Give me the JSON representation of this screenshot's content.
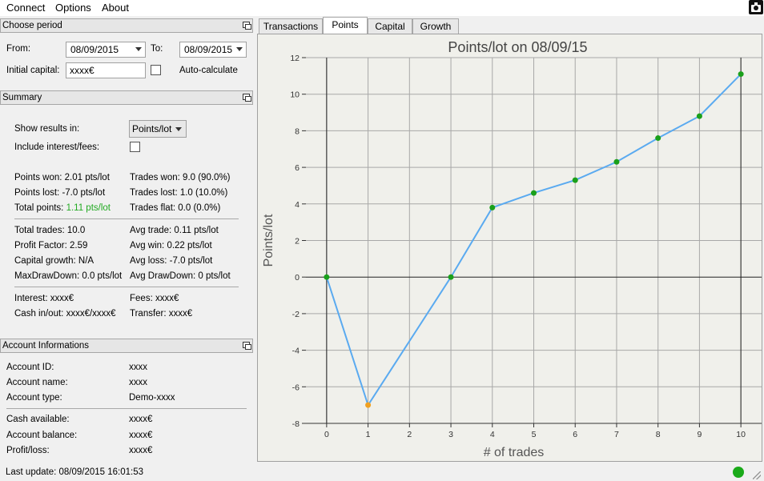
{
  "menu": {
    "connect": "Connect",
    "options": "Options",
    "about": "About"
  },
  "period": {
    "title": "Choose period",
    "from_label": "From:",
    "from_value": "08/09/2015",
    "to_label": "To:",
    "to_value": "08/09/2015",
    "capital_label": "Initial capital:",
    "capital_value": "xxxx€",
    "auto_label": "Auto-calculate"
  },
  "summary": {
    "title": "Summary",
    "show_label": "Show results in:",
    "show_value": "Points/lot",
    "interest_label": "Include interest/fees:",
    "points_won": "Points won: 2.01 pts/lot",
    "points_lost": "Points lost: -7.0 pts/lot",
    "total_points_label": "Total points:",
    "total_points_value": "1.11 pts/lot",
    "trades_won": "Trades won: 9.0 (90.0%)",
    "trades_lost": "Trades lost: 1.0 (10.0%)",
    "trades_flat": "Trades flat: 0.0 (0.0%)",
    "total_trades": "Total trades: 10.0",
    "profit_factor": "Profit Factor: 2.59",
    "capital_growth": "Capital growth: N/A",
    "max_drawdown": "MaxDrawDown: 0.0 pts/lot",
    "avg_trade": "Avg trade: 0.11 pts/lot",
    "avg_win": "Avg win: 0.22 pts/lot",
    "avg_loss": "Avg loss: -7.0 pts/lot",
    "avg_drawdown": "Avg DrawDown: 0 pts/lot",
    "interest": "Interest: xxxx€",
    "fees": "Fees: xxxx€",
    "cash": "Cash in/out: xxxx€/xxxx€",
    "transfer": "Transfer: xxxx€",
    "green": "#22aa22"
  },
  "account": {
    "title": "Account Informations",
    "rows": [
      {
        "label": "Account ID:",
        "value": "xxxx"
      },
      {
        "label": "Account name:",
        "value": "xxxx"
      },
      {
        "label": "Account type:",
        "value": "Demo-xxxx"
      },
      {
        "label": "Cash available:",
        "value": "xxxx€"
      },
      {
        "label": "Account balance:",
        "value": "xxxx€"
      },
      {
        "label": "Profit/loss:",
        "value": "xxxx€"
      }
    ]
  },
  "status": {
    "last_update": "Last update: 08/09/2015 16:01:53"
  },
  "tabs": [
    "Transactions",
    "Points",
    "Capital",
    "Growth"
  ],
  "icons": {
    "camera": "camera-icon",
    "status": "status-dot-icon"
  },
  "chart_data": {
    "type": "line",
    "title": "Points/lot on 08/09/15",
    "xlabel": "# of trades",
    "ylabel": "Points/lot",
    "x": [
      0,
      1,
      2,
      3,
      4,
      5,
      6,
      7,
      8,
      9,
      10
    ],
    "xlim": [
      -0.5,
      10.5
    ],
    "ylim": [
      -8,
      12
    ],
    "xticks": [
      0,
      1,
      2,
      3,
      4,
      5,
      6,
      7,
      8,
      9,
      10
    ],
    "yticks": [
      -8,
      -6,
      -4,
      -2,
      0,
      2,
      4,
      6,
      8,
      10,
      12
    ],
    "grid": true,
    "series": [
      {
        "points": [
          [
            0,
            0
          ],
          [
            1,
            -7
          ],
          [
            3,
            0
          ],
          [
            4,
            3.8
          ],
          [
            5,
            4.6
          ],
          [
            6,
            5.3
          ],
          [
            7,
            6.3
          ],
          [
            8,
            7.6
          ],
          [
            9,
            8.8
          ],
          [
            10,
            11.1
          ]
        ],
        "color": "#5aaaf0",
        "marker_color": "#1aa01a",
        "loss_marker_color": "#f0a020"
      }
    ]
  }
}
